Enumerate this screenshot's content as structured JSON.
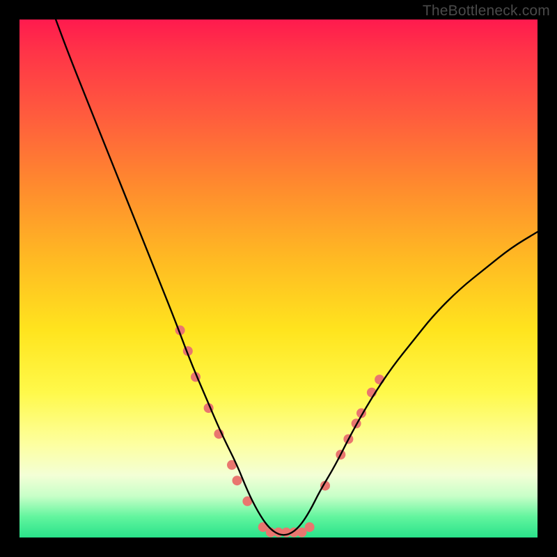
{
  "watermark": "TheBottleneck.com",
  "chart_data": {
    "type": "line",
    "title": "",
    "xlabel": "",
    "ylabel": "",
    "xlim": [
      0,
      100
    ],
    "ylim": [
      0,
      100
    ],
    "grid": false,
    "series": [
      {
        "name": "bottleneck-curve",
        "color": "#000000",
        "x": [
          7,
          10,
          14,
          18,
          22,
          26,
          30,
          33,
          36,
          39,
          42,
          44,
          46,
          48,
          50,
          52,
          54,
          56,
          58,
          61,
          64,
          68,
          72,
          76,
          80,
          85,
          90,
          95,
          100
        ],
        "y": [
          100,
          92,
          82,
          72,
          62,
          52,
          42,
          34,
          27,
          20,
          14,
          9,
          5,
          2,
          0.5,
          0.5,
          2,
          5,
          9,
          14,
          20,
          27,
          33,
          38,
          43,
          48,
          52,
          56,
          59
        ]
      }
    ],
    "markers": [
      {
        "x": 31,
        "y": 40,
        "r": 7
      },
      {
        "x": 32.5,
        "y": 36,
        "r": 7
      },
      {
        "x": 34,
        "y": 31,
        "r": 7
      },
      {
        "x": 36.5,
        "y": 25,
        "r": 7
      },
      {
        "x": 38.5,
        "y": 20,
        "r": 7
      },
      {
        "x": 41,
        "y": 14,
        "r": 7
      },
      {
        "x": 42,
        "y": 11,
        "r": 7
      },
      {
        "x": 44,
        "y": 7,
        "r": 7
      },
      {
        "x": 47,
        "y": 2,
        "r": 7
      },
      {
        "x": 48.5,
        "y": 1,
        "r": 7
      },
      {
        "x": 50,
        "y": 1,
        "r": 7
      },
      {
        "x": 51.5,
        "y": 1,
        "r": 7
      },
      {
        "x": 53,
        "y": 1,
        "r": 7
      },
      {
        "x": 54.5,
        "y": 1,
        "r": 7
      },
      {
        "x": 56,
        "y": 2,
        "r": 7
      },
      {
        "x": 59,
        "y": 10,
        "r": 7
      },
      {
        "x": 62,
        "y": 16,
        "r": 7
      },
      {
        "x": 63.5,
        "y": 19,
        "r": 7
      },
      {
        "x": 65,
        "y": 22,
        "r": 7
      },
      {
        "x": 66,
        "y": 24,
        "r": 7
      },
      {
        "x": 68,
        "y": 28,
        "r": 7
      },
      {
        "x": 69.5,
        "y": 30.5,
        "r": 7
      }
    ],
    "marker_color": "#e9766f",
    "gradient_stops": [
      {
        "pos": 0,
        "color": "#ff1a4e"
      },
      {
        "pos": 18,
        "color": "#ff5a3e"
      },
      {
        "pos": 46,
        "color": "#ffb923"
      },
      {
        "pos": 72,
        "color": "#fff94a"
      },
      {
        "pos": 88,
        "color": "#f3ffd6"
      },
      {
        "pos": 100,
        "color": "#29e28a"
      }
    ]
  }
}
